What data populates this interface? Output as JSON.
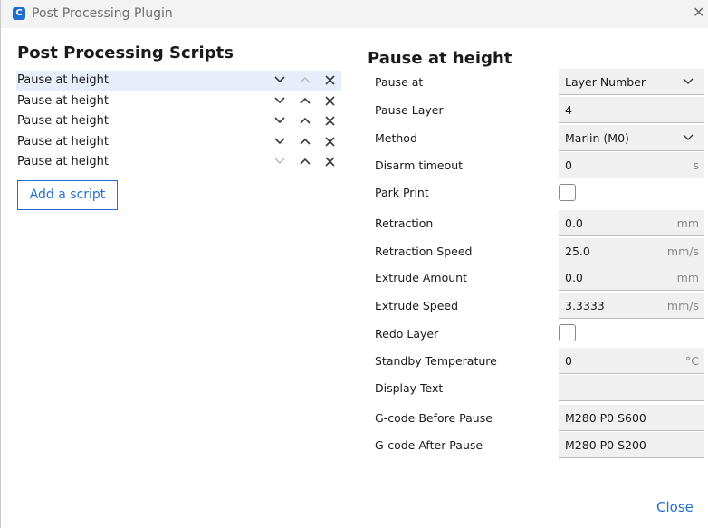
{
  "window": {
    "title": "Post Processing Plugin",
    "app_icon_glyph": "C"
  },
  "scripts_panel": {
    "heading": "Post Processing Scripts",
    "scripts": [
      {
        "label": "Pause at height",
        "selected": true,
        "up_enabled": false,
        "down_enabled": true
      },
      {
        "label": "Pause at height",
        "selected": false,
        "up_enabled": true,
        "down_enabled": true
      },
      {
        "label": "Pause at height",
        "selected": false,
        "up_enabled": true,
        "down_enabled": true
      },
      {
        "label": "Pause at height",
        "selected": false,
        "up_enabled": true,
        "down_enabled": true
      },
      {
        "label": "Pause at height",
        "selected": false,
        "up_enabled": true,
        "down_enabled": false
      }
    ],
    "add_button_label": "Add a script"
  },
  "settings_panel": {
    "heading": "Pause at height",
    "pause_at": {
      "label": "Pause at",
      "value": "Layer Number"
    },
    "pause_layer": {
      "label": "Pause Layer",
      "value": "4"
    },
    "method": {
      "label": "Method",
      "value": "Marlin (M0)"
    },
    "disarm_timeout": {
      "label": "Disarm timeout",
      "value": "0",
      "unit": "s"
    },
    "park_print": {
      "label": "Park Print",
      "checked": false
    },
    "retraction": {
      "label": "Retraction",
      "value": "0.0",
      "unit": "mm"
    },
    "retraction_speed": {
      "label": "Retraction Speed",
      "value": "25.0",
      "unit": "mm/s"
    },
    "extrude_amount": {
      "label": "Extrude Amount",
      "value": "0.0",
      "unit": "mm"
    },
    "extrude_speed": {
      "label": "Extrude Speed",
      "value": "3.3333",
      "unit": "mm/s"
    },
    "redo_layer": {
      "label": "Redo Layer",
      "checked": false
    },
    "standby_temperature": {
      "label": "Standby Temperature",
      "value": "0",
      "unit": "°C"
    },
    "display_text": {
      "label": "Display Text",
      "value": ""
    },
    "gcode_before": {
      "label": "G-code Before Pause",
      "value": "M280 P0 S600"
    },
    "gcode_after": {
      "label": "G-code After Pause",
      "value": "M280 P0 S200"
    }
  },
  "footer": {
    "close_label": "Close"
  },
  "colors": {
    "accent": "#1f6fd0",
    "selected_row": "#e8eef9",
    "field_bg": "#f0f0f0",
    "disabled_icon": "#c0c0c0"
  },
  "icons": {
    "down": "chevron-down-icon",
    "up": "chevron-up-icon",
    "remove": "close-icon",
    "combo": "chevron-down-icon"
  }
}
